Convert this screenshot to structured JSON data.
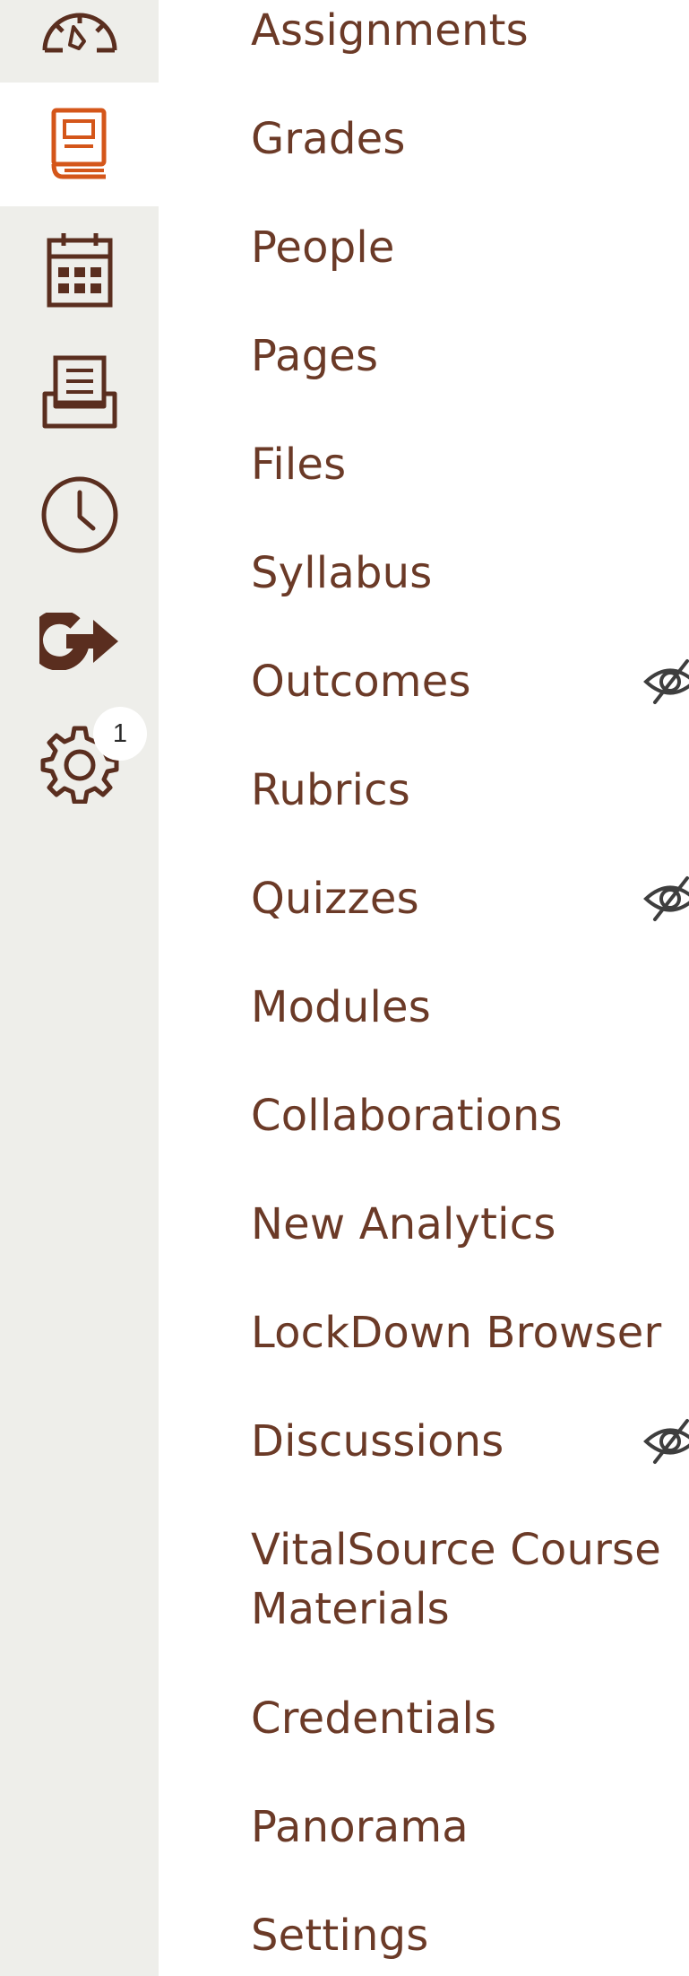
{
  "global_nav": {
    "items": [
      {
        "icon": "dashboard-icon",
        "active": false
      },
      {
        "icon": "courses-icon",
        "active": true
      },
      {
        "icon": "calendar-icon",
        "active": false
      },
      {
        "icon": "inbox-icon",
        "active": false
      },
      {
        "icon": "history-icon",
        "active": false
      },
      {
        "icon": "commons-icon",
        "active": false
      },
      {
        "icon": "gear-icon",
        "active": false
      }
    ],
    "notification_badge": "1",
    "colors": {
      "rail_background": "#eeeeea",
      "active_icon": "#d4561a",
      "icon": "#5a2e1f"
    }
  },
  "course_nav": {
    "link_color": "#6b3a27",
    "items": [
      {
        "label": "Assignments",
        "hidden_from_students": false
      },
      {
        "label": "Grades",
        "hidden_from_students": false
      },
      {
        "label": "People",
        "hidden_from_students": false
      },
      {
        "label": "Pages",
        "hidden_from_students": false
      },
      {
        "label": "Files",
        "hidden_from_students": false
      },
      {
        "label": "Syllabus",
        "hidden_from_students": false
      },
      {
        "label": "Outcomes",
        "hidden_from_students": true
      },
      {
        "label": "Rubrics",
        "hidden_from_students": false
      },
      {
        "label": "Quizzes",
        "hidden_from_students": true
      },
      {
        "label": "Modules",
        "hidden_from_students": false
      },
      {
        "label": "Collaborations",
        "hidden_from_students": false
      },
      {
        "label": "New Analytics",
        "hidden_from_students": false
      },
      {
        "label": "LockDown Browser",
        "hidden_from_students": false
      },
      {
        "label": "Discussions",
        "hidden_from_students": true
      },
      {
        "label": "VitalSource Course Materials",
        "hidden_from_students": false
      },
      {
        "label": "Credentials",
        "hidden_from_students": false
      },
      {
        "label": "Panorama",
        "hidden_from_students": false
      },
      {
        "label": "Settings",
        "hidden_from_students": false
      }
    ]
  }
}
